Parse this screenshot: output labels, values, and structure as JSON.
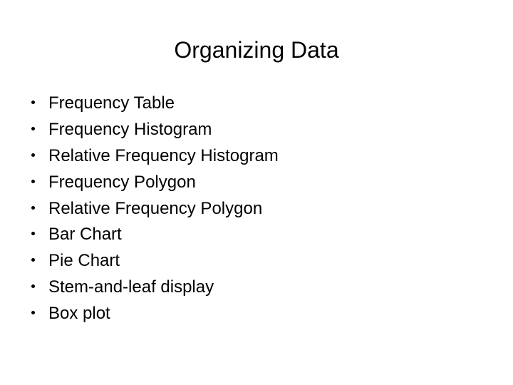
{
  "slide": {
    "title": "Organizing Data",
    "background_color": "#ffffff",
    "text_color": "#000000",
    "bullet_items": [
      {
        "label": "Frequency Table"
      },
      {
        "label": "Frequency Histogram"
      },
      {
        "label": "Relative Frequency Histogram"
      },
      {
        "label": "Frequency Polygon"
      },
      {
        "label": "Relative Frequency Polygon"
      },
      {
        "label": "Bar Chart"
      },
      {
        "label": "Pie Chart"
      },
      {
        "label": "Stem-and-leaf display"
      },
      {
        "label": "Box plot"
      }
    ]
  }
}
